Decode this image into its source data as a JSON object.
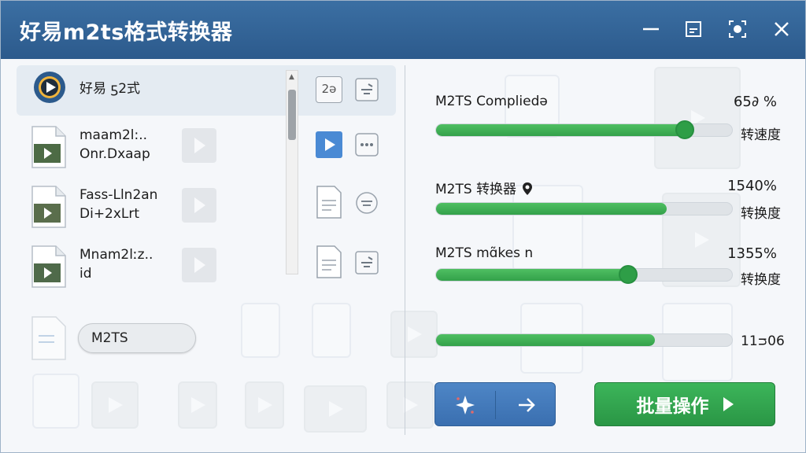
{
  "window": {
    "title": "好易m2ts格式转换器"
  },
  "files": [
    {
      "name_line1": "好易 ƽ2式",
      "name_line2": "",
      "action_label": "2ə"
    },
    {
      "name_line1": "maam2l:..",
      "name_line2": "Onr.Dxaap"
    },
    {
      "name_line1": "Fass-Lln2an",
      "name_line2": "Di+2xLrt"
    },
    {
      "name_line1": "Mnam2lːz..",
      "name_line2": "id"
    }
  ],
  "m2ts_pill": "M2TS",
  "progress": [
    {
      "label": "M2TS Compliedə",
      "percent_text": "65∂ %",
      "side": "转速度",
      "fill": 0.84,
      "knob": true
    },
    {
      "label": "M2TS 转换器",
      "percent_text": "1540%",
      "side": "转换度",
      "fill": 0.78,
      "knob": false
    },
    {
      "label": "M2TS mɑ̃kes n",
      "percent_text": "1355%",
      "side": "转换度",
      "fill": 0.65,
      "knob": true
    },
    {
      "label": "",
      "percent_text": "11ᴝ06",
      "side": "",
      "fill": 0.74,
      "knob": false
    }
  ],
  "buttons": {
    "batch": "批量操作"
  },
  "colors": {
    "titlebar": "#2f5f93",
    "progress": "#3aae52",
    "primary_blue": "#4278b8",
    "batch_green": "#31a44e"
  }
}
